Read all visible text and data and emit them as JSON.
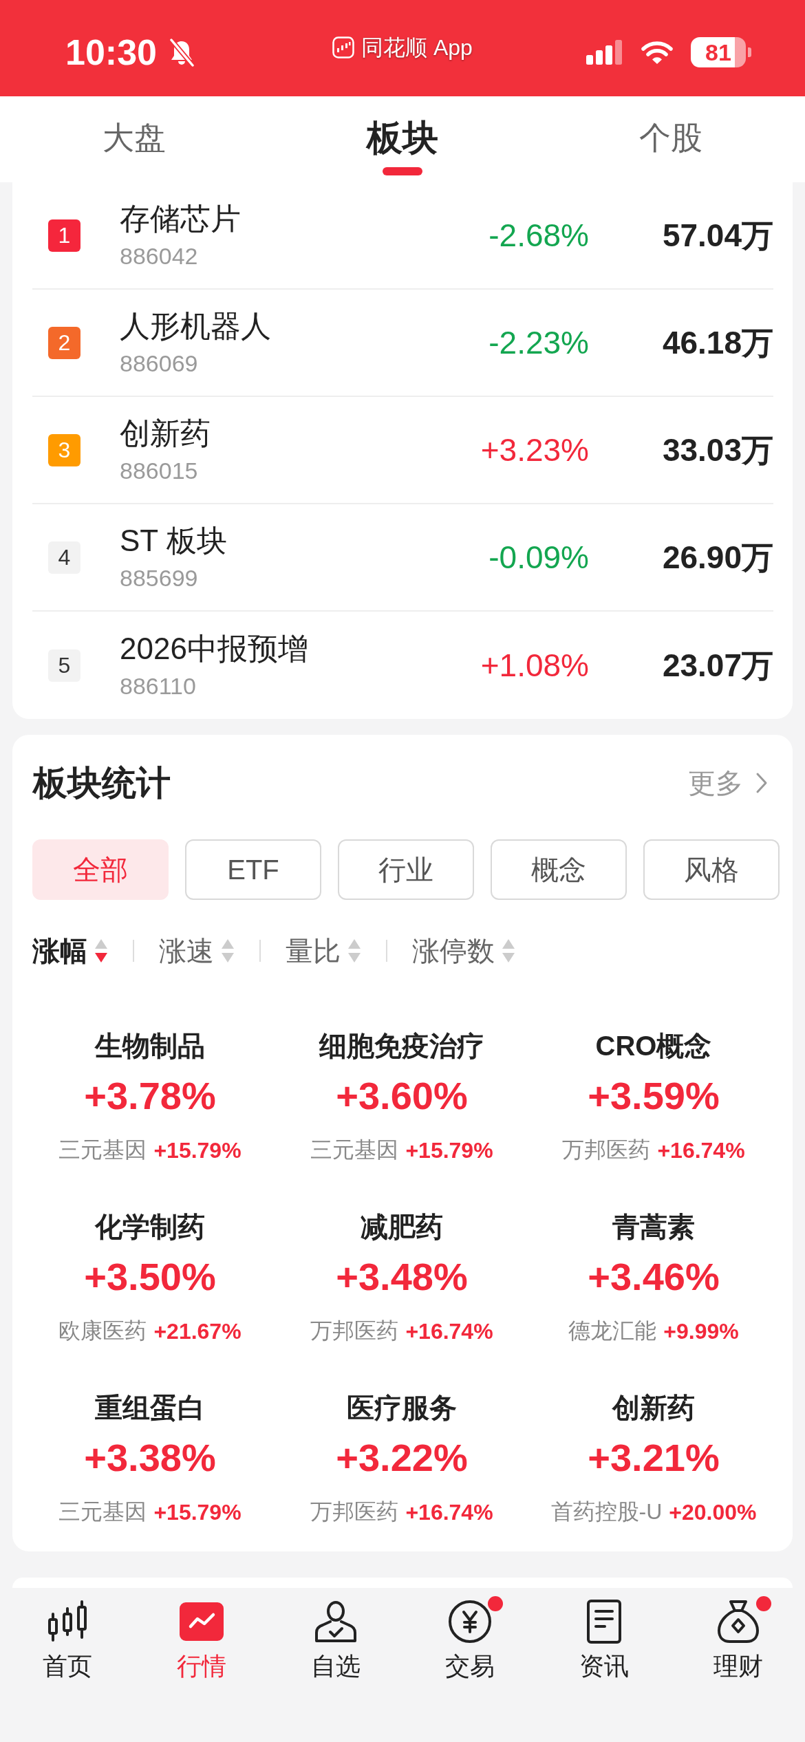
{
  "status_bar": {
    "time": "10:30",
    "app_name": "同花顺 App",
    "battery": "81"
  },
  "tabs": [
    {
      "label": "大盘",
      "selected": false
    },
    {
      "label": "板块",
      "selected": true
    },
    {
      "label": "个股",
      "selected": false
    }
  ],
  "sector_ranking": [
    {
      "rank": "1",
      "color": "#f5263c",
      "name": "存储芯片",
      "code": "886042",
      "change": "-2.68%",
      "rising": false,
      "volume": "57.04万"
    },
    {
      "rank": "2",
      "color": "#f4692a",
      "name": "人形机器人",
      "code": "886069",
      "change": "-2.23%",
      "rising": false,
      "volume": "46.18万"
    },
    {
      "rank": "3",
      "color": "#ff9b00",
      "name": "创新药",
      "code": "886015",
      "change": "+3.23%",
      "rising": true,
      "volume": "33.03万"
    },
    {
      "rank": "4",
      "color": "#f2f2f2",
      "name": "ST 板块",
      "code": "885699",
      "change": "-0.09%",
      "rising": false,
      "volume": "26.90万"
    },
    {
      "rank": "5",
      "color": "#f2f2f2",
      "name": "2026中报预增",
      "code": "886110",
      "change": "+1.08%",
      "rising": true,
      "volume": "23.07万"
    }
  ],
  "sector_stats": {
    "title": "板块统计",
    "more": "更多",
    "filters": [
      {
        "label": "全部",
        "selected": true
      },
      {
        "label": "ETF",
        "selected": false
      },
      {
        "label": "行业",
        "selected": false
      },
      {
        "label": "概念",
        "selected": false
      },
      {
        "label": "风格",
        "selected": false
      }
    ],
    "sort_options": [
      {
        "label": "涨幅",
        "selected": true
      },
      {
        "label": "涨速",
        "selected": false
      },
      {
        "label": "量比",
        "selected": false
      },
      {
        "label": "涨停数",
        "selected": false
      }
    ],
    "items": [
      {
        "name": "生物制品",
        "change": "+3.78%",
        "leader": "三元基因",
        "leader_change": "+15.79%"
      },
      {
        "name": "细胞免疫治疗",
        "change": "+3.60%",
        "leader": "三元基因",
        "leader_change": "+15.79%"
      },
      {
        "name": "CRO概念",
        "change": "+3.59%",
        "leader": "万邦医药",
        "leader_change": "+16.74%"
      },
      {
        "name": "化学制药",
        "change": "+3.50%",
        "leader": "欧康医药",
        "leader_change": "+21.67%"
      },
      {
        "name": "减肥药",
        "change": "+3.48%",
        "leader": "万邦医药",
        "leader_change": "+16.74%"
      },
      {
        "name": "青蒿素",
        "change": "+3.46%",
        "leader": "德龙汇能",
        "leader_change": "+9.99%"
      },
      {
        "name": "重组蛋白",
        "change": "+3.38%",
        "leader": "三元基因",
        "leader_change": "+15.79%"
      },
      {
        "name": "医疗服务",
        "change": "+3.22%",
        "leader": "万邦医药",
        "leader_change": "+16.74%"
      },
      {
        "name": "创新药",
        "change": "+3.21%",
        "leader": "首药控股-U",
        "leader_change": "+20.00%"
      }
    ]
  },
  "bottom_nav": [
    {
      "label": "首页",
      "selected": false,
      "badge": false
    },
    {
      "label": "行情",
      "selected": true,
      "badge": false
    },
    {
      "label": "自选",
      "selected": false,
      "badge": false
    },
    {
      "label": "交易",
      "selected": false,
      "badge": true
    },
    {
      "label": "资讯",
      "selected": false,
      "badge": false
    },
    {
      "label": "理财",
      "selected": false,
      "badge": true
    }
  ]
}
